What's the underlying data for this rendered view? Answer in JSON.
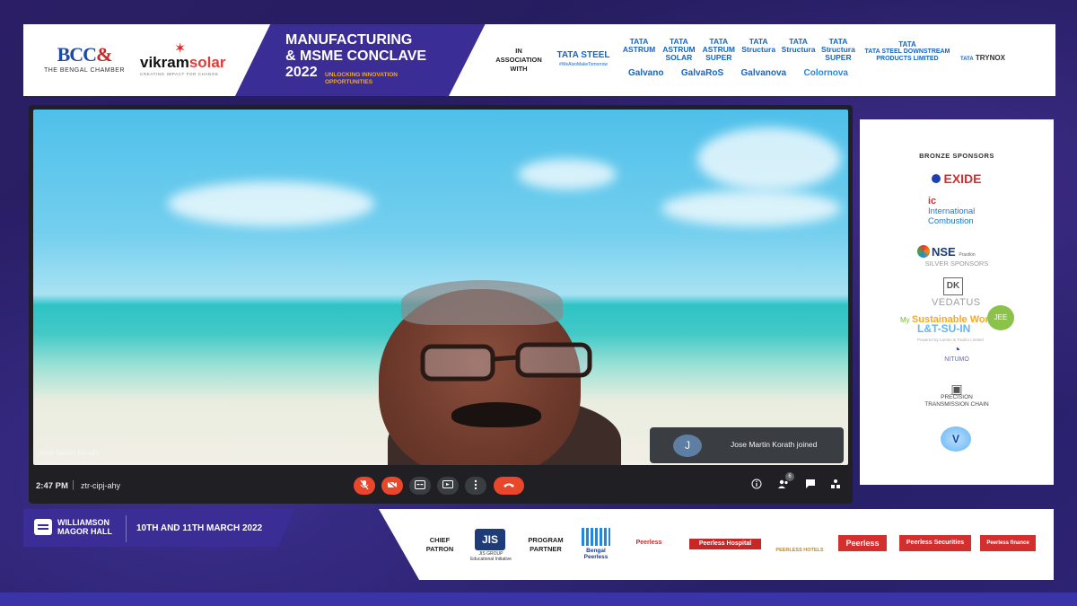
{
  "header": {
    "bcc_logo": "BCC",
    "bcc_amp": "&",
    "bcc_sub": "THE BENGAL CHAMBER",
    "vikram_a": "vikram",
    "vikram_b": "solar",
    "vikram_tag": "CREATING IMPACT FOR CHANGE",
    "title_line1": "MANUFACTURING",
    "title_line2": "& MSME CONCLAVE",
    "title_line3": "2022",
    "tagline": "UNLOCKING INNOVATION OPPORTUNITIES",
    "assoc_label": "IN ASSOCIATION WITH",
    "tata_steel": "TATA STEEL",
    "tata_steel_sub": "#WeAlsoMakeTomorrow",
    "brands_top": [
      "TATA ASTRUM",
      "TATA ASTRUM SOLAR",
      "TATA ASTRUM SUPER",
      "TATA Structura",
      "TATA Structura",
      "TATA Structura SUPER"
    ],
    "brands_bottom": [
      "Galvano",
      "GalvaRoS",
      "Galvanova",
      "Colornova"
    ],
    "tata_downstream": "TATA STEEL DOWNSTREAM PRODUCTS LIMITED",
    "tata_word": "TATA",
    "tiscon_prefix": "TATA",
    "tiscon": "TRYNOX"
  },
  "meeting": {
    "self_name": "Jose Martin Korath",
    "toast_initial": "J",
    "toast_text": "Jose Martin Korath joined",
    "time": "2:47 PM",
    "separator": "|",
    "meeting_code": "ztr-cipj-ahy",
    "controls": [
      "mic-off",
      "camera-off",
      "captions",
      "present",
      "more",
      "end-call"
    ],
    "right_controls": [
      "info",
      "people",
      "chat",
      "activities"
    ],
    "people_badge": "6"
  },
  "sponsors": {
    "bronze_title": "BRONZE SPONSORS",
    "exide": "EXIDE",
    "ic_mark": "ic",
    "ic_line1": "International",
    "ic_line2": "Combustion",
    "nse": "NSE",
    "nse_sub": "Prastlon",
    "silver_title": "SILVER SPONSORS",
    "dk": "DK",
    "vedatus": "VEDATUS",
    "msw_prefix": "My",
    "msw": "Sustainable World",
    "msw_badge": "JEE",
    "lt": "L&T-SU-IN",
    "lt_sub": "Powered by Larsen & Toubro Limited",
    "nitumo": "NITUMO",
    "ptc_line1": "PRECISION",
    "ptc_line2": "TRANSMISSION CHAIN",
    "v_mark": "V"
  },
  "footer": {
    "venue_line1": "WILLIAMSON",
    "venue_line2": "MAGOR HALL",
    "dates": "10TH AND 11TH MARCH 2022",
    "chief_patron_label": "CHIEF PATRON",
    "jis": "JIS",
    "jis_sub": "JIS GROUP Educational Initiative",
    "program_partner_label": "PROGRAM PARTNER",
    "bengal_peerless": "Bengal Peerless",
    "partner_chips": [
      "Peerless",
      "Peerless Hospital",
      "PEERLESS HOTELS",
      "Peerless",
      "Peerless Securities",
      "Peerless finance"
    ]
  }
}
